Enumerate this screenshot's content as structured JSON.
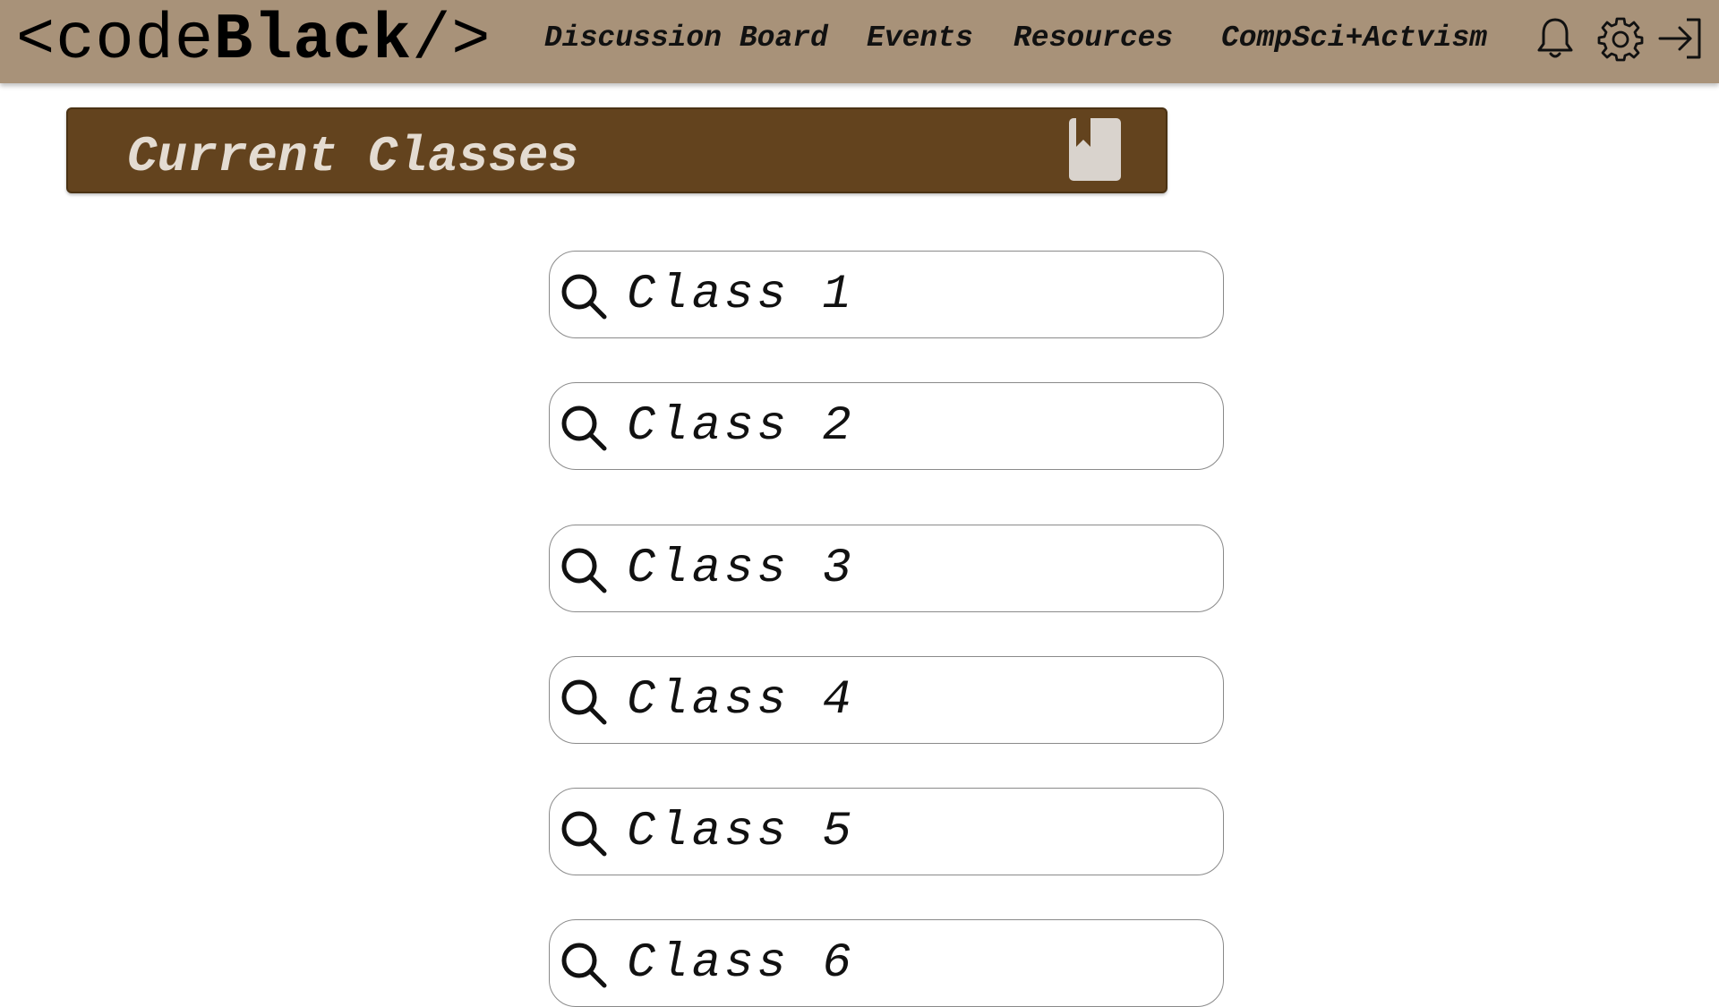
{
  "header": {
    "logo_prefix": "<code",
    "logo_bold": "Black",
    "logo_suffix": "/>",
    "nav": [
      {
        "label": "Discussion Board"
      },
      {
        "label": "Events"
      },
      {
        "label": "Resources"
      },
      {
        "label": "CompSci+Actvism"
      }
    ],
    "icons": [
      "bell-icon",
      "gear-icon",
      "logout-icon"
    ]
  },
  "banner": {
    "title": "Current Classes",
    "icon": "book-icon"
  },
  "classes": [
    {
      "label": "Class 1"
    },
    {
      "label": "Class 2"
    },
    {
      "label": "Class 3"
    },
    {
      "label": "Class 4"
    },
    {
      "label": "Class 5"
    },
    {
      "label": "Class 6"
    }
  ],
  "colors": {
    "header_bg": "#a89279",
    "banner_bg": "#63431e",
    "banner_text": "#e4dcd2"
  }
}
